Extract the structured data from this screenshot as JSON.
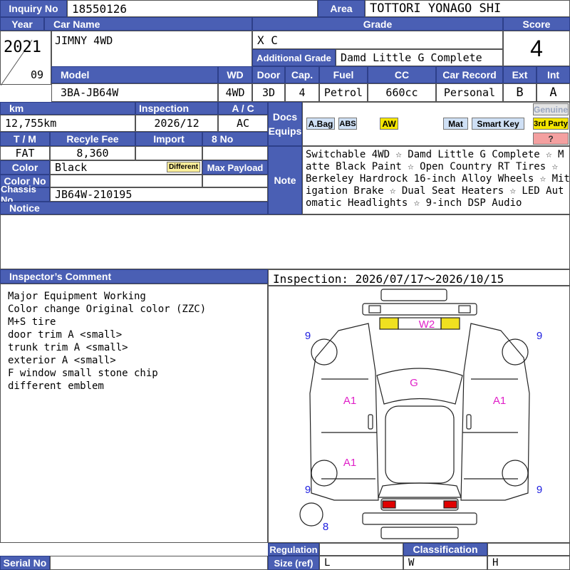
{
  "header": {
    "inquiry_label": "Inquiry No",
    "inquiry_value": "18550126",
    "area_label": "Area",
    "area_value": "TOTTORI YONAGO SHI"
  },
  "labels": {
    "year": "Year",
    "car_name": "Car Name",
    "grade": "Grade",
    "score": "Score",
    "additional_grade": "Additional Grade",
    "model": "Model",
    "wd": "WD",
    "door": "Door",
    "cap": "Cap.",
    "fuel": "Fuel",
    "cc": "CC",
    "car_record": "Car Record",
    "ext": "Ext",
    "int": "Int",
    "km": "km",
    "inspection": "Inspection",
    "ac": "A / C",
    "docs": "Docs",
    "equips": "Equips",
    "tm": "T / M",
    "recycle_fee": "Recyle Fee",
    "import": "Import",
    "eight_no": "8 No",
    "color": "Color",
    "max_payload": "Max Payload",
    "color_no": "Color No",
    "note": "Note",
    "chassis_no": "Chassis No",
    "notice": "Notice",
    "inspector_comment": "Inspector’s Comment",
    "regulation": "Regulation",
    "classification": "Classification",
    "size_ref": "Size (ref)",
    "serial_no": "Serial No"
  },
  "vehicle": {
    "year": "2021",
    "month": "09",
    "car_name": "JIMNY 4WD",
    "grade": "X C",
    "additional_grade": "Damd Little G Complete",
    "score": "4",
    "model": "3BA-JB64W",
    "wd": "4WD",
    "door": "3D",
    "cap": "4",
    "fuel": "Petrol",
    "cc": "660cc",
    "car_record": "Personal",
    "ext": "B",
    "int": "A",
    "km": "12,755km",
    "inspection": "2026/12",
    "ac": "AC",
    "tm": "FAT",
    "recycle_fee": "8,360",
    "color": "Black",
    "color_different": "Different",
    "chassis_no": "JB64W-210195"
  },
  "equipment": {
    "abag": "A.Bag",
    "abs": "ABS",
    "aw": "AW",
    "mat": "Mat",
    "smart_key": "Smart Key",
    "genuine": "Genuine",
    "third_party": "3rd Party",
    "unknown": "?"
  },
  "note_text": "Switchable 4WD ☆ Damd Little G Complete ☆ Matte Black Paint ☆ Open Country RT Tires ☆ Berkeley Hardrock 16-inch Alloy Wheels ☆ Mitigation Brake ☆ Dual Seat Heaters ☆ LED Automatic Headlights ☆ 9-inch DSP Audio",
  "note_lines": [
    "Switchable 4WD ☆ Damd Little G Complete ☆ M",
    "atte Black Paint ☆ Open Country RT Tires ☆",
    "Berkeley Hardrock 16-inch Alloy Wheels ☆ Mit",
    "igation Brake ☆ Dual Seat Heaters ☆ LED Aut",
    "omatic Headlights ☆ 9-inch DSP Audio"
  ],
  "inspection_period": "Inspection: 2026/07/17〜2026/10/15",
  "comments": [
    "Major Equipment Working",
    "Color change Original color (ZZC)",
    "M+S tire",
    "door trim A <small>",
    "trunk trim A <small>",
    "exterior A <small>",
    "F window small stone chip",
    "different emblem"
  ],
  "damage_marks": {
    "front_bumper": "W2",
    "windshield": "G",
    "left_front_door": "A1",
    "right_front_door": "A1",
    "left_rear": "A1",
    "tire_fl": "9",
    "tire_fr": "9",
    "tire_rl": "9",
    "tire_rr": "9",
    "spare_tire": "8"
  },
  "size_ref": {
    "l": "L",
    "w": "W",
    "h": "H"
  },
  "colors": {
    "header_blue": "#4a5fb4",
    "mark_magenta": "#e020c8",
    "mark_blue": "#2020e0",
    "headlight_yellow": "#f0e020",
    "taillight_red": "#e00000"
  }
}
